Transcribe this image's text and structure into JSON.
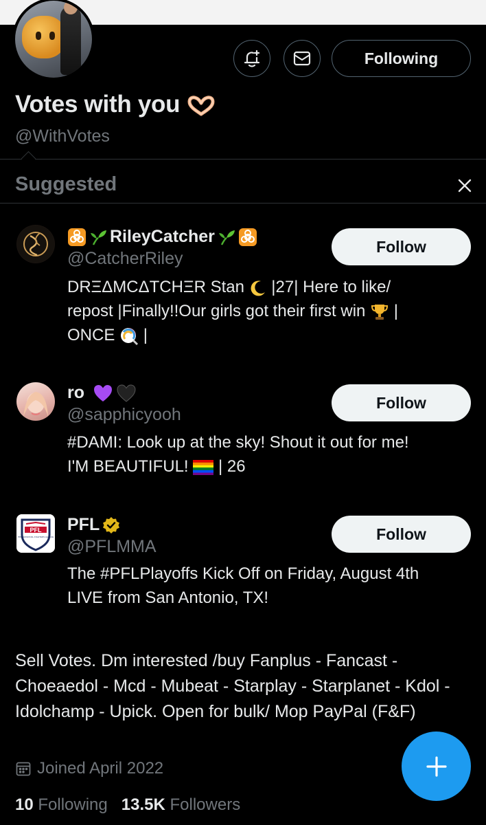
{
  "profile": {
    "display_name": "Votes with you",
    "name_emoji": "heart-hands-icon",
    "handle": "@WithVotes",
    "following_button": "Following",
    "bio": "Sell Votes. Dm interested /buy Fanplus - Fancast - Choeaedol - Mcd - Mubeat - Starplay - Starplanet - Kdol - Idolchamp - Upick. Open for bulk/ Mop PayPal (F&F)",
    "joined": "Joined April 2022",
    "following_count": "10",
    "following_label": "Following",
    "followers_count": "13.5K",
    "followers_label": "Followers"
  },
  "suggested": {
    "title": "Suggested",
    "follow_label": "Follow",
    "accounts": [
      {
        "name": "RileyCatcher",
        "handle": "@CatcherRiley",
        "bio_line1": "DRΞΔMCΔTCHΞR Stan",
        "bio_line1b": "|27| Here to like/",
        "bio_line2": "repost |Finally!!Our girls got their first win",
        "bio_line2b": "|",
        "bio_line3": "ONCE",
        "bio_line3b": "|"
      },
      {
        "name": "ro",
        "handle": "@sapphicyooh",
        "bio_line1": "#DAMI: Look up at the sky! Shout it out for me!",
        "bio_line2": "I'M BEAUTIFUL!",
        "bio_line2b": "| 26"
      },
      {
        "name": "PFL",
        "handle": "@PFLMMA",
        "bio_line1": "The #PFLPlayoffs Kick Off on Friday, August 4th",
        "bio_line2": "LIVE from San Antonio, TX!",
        "logo_text": "PFL",
        "logo_subtext": "PROFESSIONAL FIGHTERS LEAGUE"
      }
    ]
  },
  "colors": {
    "background": "#000000",
    "text": "#e7e9ea",
    "muted": "#71767b",
    "accent": "#1d9bf0",
    "verified_gold": "#e2b719"
  }
}
